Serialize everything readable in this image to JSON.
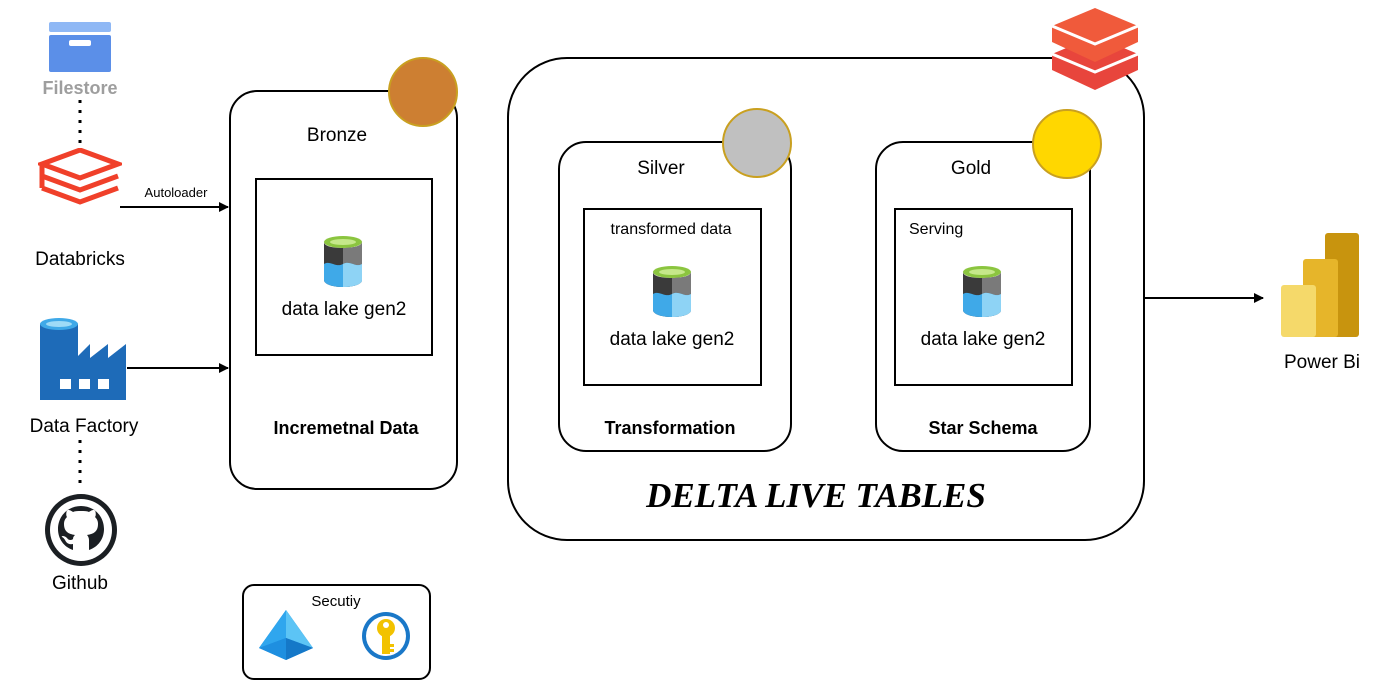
{
  "sources": {
    "filestore": "Filestore",
    "databricks": "Databricks",
    "data_factory": "Data Factory",
    "github": "Github",
    "autoloader": "Autoloader"
  },
  "bronze": {
    "title": "Bronze",
    "store_label": "data lake gen2",
    "caption": "Incremetnal Data",
    "badge_color": "#CD7F32"
  },
  "dlt": {
    "title": "DELTA LIVE TABLES",
    "silver": {
      "title": "Silver",
      "inner_label": "transformed data",
      "store_label": "data lake gen2",
      "caption": "Transformation",
      "badge_color": "#C0C0C0"
    },
    "gold": {
      "title": "Gold",
      "inner_label": "Serving",
      "store_label": "data lake gen2",
      "caption": "Star Schema",
      "badge_color": "#FFD700"
    }
  },
  "output": {
    "label": "Power Bi"
  },
  "security": {
    "title": "Secutiy"
  },
  "icons": {
    "filestore": "filestore-icon",
    "databricks": "databricks-icon",
    "data_factory": "data-factory-icon",
    "github": "github-icon",
    "data_lake": "data-lake-icon",
    "delta_live_tables": "delta-live-tables-icon",
    "power_bi": "power-bi-icon",
    "entra_id": "entra-id-icon",
    "key_vault": "key-vault-icon"
  }
}
